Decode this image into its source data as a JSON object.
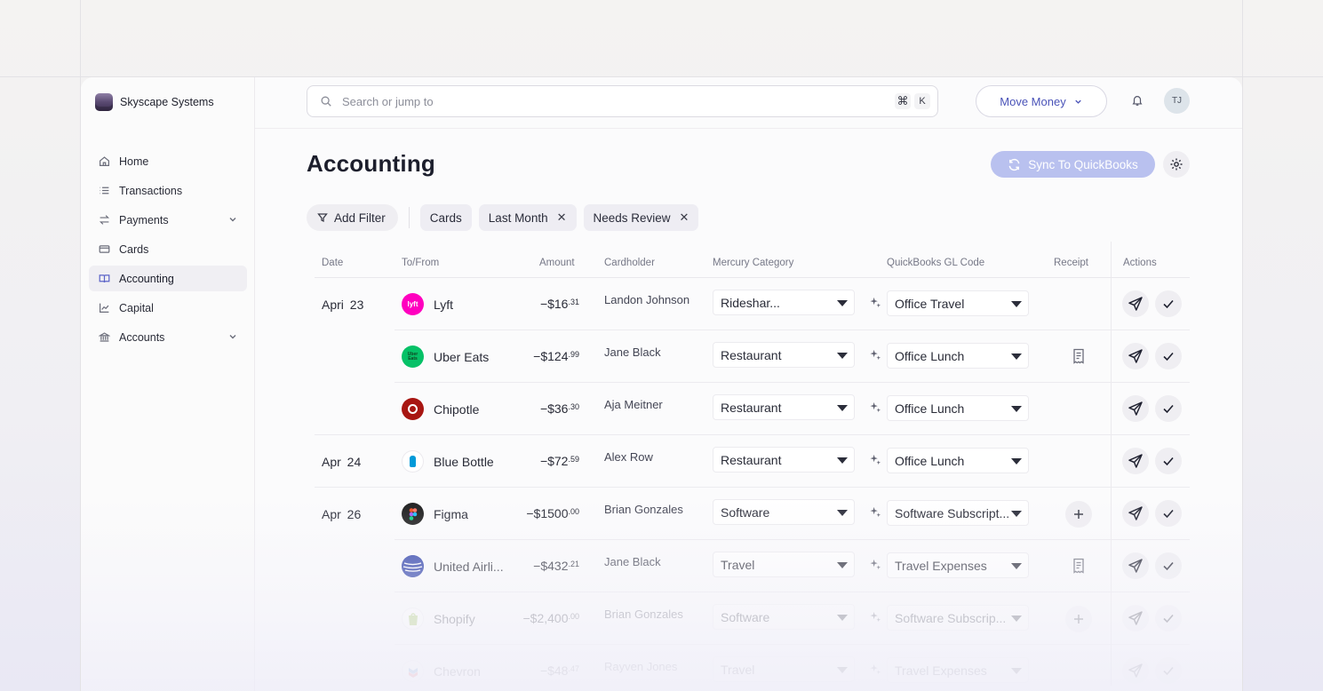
{
  "org": {
    "name": "Skyscape Systems"
  },
  "sidebar": {
    "items": [
      {
        "label": "Home",
        "icon": "home-icon"
      },
      {
        "label": "Transactions",
        "icon": "list-icon"
      },
      {
        "label": "Payments",
        "icon": "transfer-icon"
      },
      {
        "label": "Cards",
        "icon": "card-icon"
      },
      {
        "label": "Accounting",
        "icon": "book-icon",
        "active": true
      },
      {
        "label": "Capital",
        "icon": "chart-line-icon"
      },
      {
        "label": "Accounts",
        "icon": "bank-icon"
      }
    ]
  },
  "topbar": {
    "search_placeholder": "Search or jump to",
    "shortcut_key1": "⌘",
    "shortcut_key2": "K",
    "move_money": "Move Money",
    "avatar_initials": "TJ"
  },
  "page": {
    "title": "Accounting",
    "sync_button": "Sync To QuickBooks"
  },
  "filters": {
    "add_filter": "Add Filter",
    "chips": [
      "Cards",
      "Last Month",
      "Needs Review"
    ]
  },
  "table": {
    "columns": {
      "date": "Date",
      "to_from": "To/From",
      "amount": "Amount",
      "cardholder": "Cardholder",
      "mercury_category": "Mercury Category",
      "gl_code": "QuickBooks GL Code",
      "receipt": "Receipt",
      "actions": "Actions"
    },
    "rows": [
      {
        "date": "Apri  23",
        "merchant": "Lyft",
        "amount_main": "−$16",
        "amount_cents": ".31",
        "cardholder": "Landon Johnson",
        "category": "Rideshar...",
        "gl_code": "Office Travel",
        "receipt": "none"
      },
      {
        "date": "",
        "merchant": "Uber Eats",
        "amount_main": "−$124",
        "amount_cents": ".99",
        "cardholder": "Jane Black",
        "category": "Restaurant",
        "gl_code": "Office Lunch",
        "receipt": "attached"
      },
      {
        "date": "",
        "merchant": "Chipotle",
        "amount_main": "−$36",
        "amount_cents": ".30",
        "cardholder": "Aja Meitner",
        "category": "Restaurant",
        "gl_code": "Office Lunch",
        "receipt": "none"
      },
      {
        "date": "Apr  24",
        "merchant": "Blue Bottle",
        "amount_main": "−$72",
        "amount_cents": ".59",
        "cardholder": "Alex Row",
        "category": "Restaurant",
        "gl_code": "Office Lunch",
        "receipt": "none"
      },
      {
        "date": "Apr  26",
        "merchant": "Figma",
        "amount_main": "−$1500",
        "amount_cents": ".00",
        "cardholder": "Brian Gonzales",
        "category": "Software",
        "gl_code": "Software Subscript...",
        "receipt": "add"
      },
      {
        "date": "",
        "merchant": "United Airli...",
        "amount_main": "−$432",
        "amount_cents": ".21",
        "cardholder": "Jane Black",
        "category": "Travel",
        "gl_code": "Travel Expenses",
        "receipt": "attached"
      },
      {
        "date": "",
        "merchant": "Shopify",
        "amount_main": "−$2,400",
        "amount_cents": ".00",
        "cardholder": "Brian Gonzales",
        "category": "Software",
        "gl_code": "Software Subscrip...",
        "receipt": "add"
      },
      {
        "date": "",
        "merchant": "Chevron",
        "amount_main": "−$48",
        "amount_cents": ".47",
        "cardholder": "Rayven Jones",
        "category": "Travel",
        "gl_code": "Travel Expenses",
        "receipt": "none"
      }
    ]
  },
  "colors": {
    "accent": "#4a53b8",
    "sync_button": "#b9c1ef",
    "lyft": "#ff00bf",
    "uber_eats": "#06c167",
    "chipotle": "#a81612",
    "blue_bottle": "#0099d8",
    "figma": "#1e1e1e",
    "united": "#2b3ea8",
    "shopify": "#95bf47",
    "chevron": "#1d6fb8"
  }
}
